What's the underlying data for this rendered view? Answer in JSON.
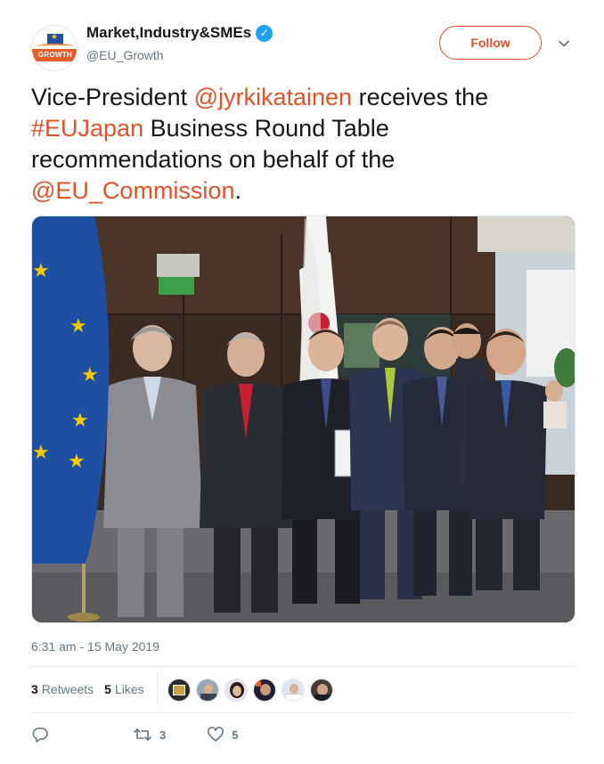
{
  "account": {
    "display_name": "Market,Industry&SMEs",
    "handle": "@EU_Growth",
    "avatar_text": "GROWTH",
    "verified_icon": "verified-badge-icon"
  },
  "follow_button": {
    "label": "Follow"
  },
  "tweet": {
    "segments": [
      {
        "text": "Vice-President ",
        "link": false
      },
      {
        "text": "@jyrkikatainen",
        "link": true
      },
      {
        "text": " receives the ",
        "link": false
      },
      {
        "text": "#EUJapan",
        "link": true
      },
      {
        "text": " Business Round Table recommendations on behalf of the ",
        "link": false
      },
      {
        "text": "@EU_Commission",
        "link": true
      },
      {
        "text": ".",
        "link": false
      }
    ],
    "link_color": "#e0532a"
  },
  "timestamp": "6:31 am - 15 May 2019",
  "stats": {
    "retweets_count": "3",
    "retweets_label": "Retweets",
    "likes_count": "5",
    "likes_label": "Likes"
  },
  "actions": {
    "reply_count": "",
    "retweet_count": "3",
    "like_count": "5"
  },
  "colors": {
    "accent": "#e0532a",
    "muted": "#657786",
    "text": "#14171a"
  }
}
